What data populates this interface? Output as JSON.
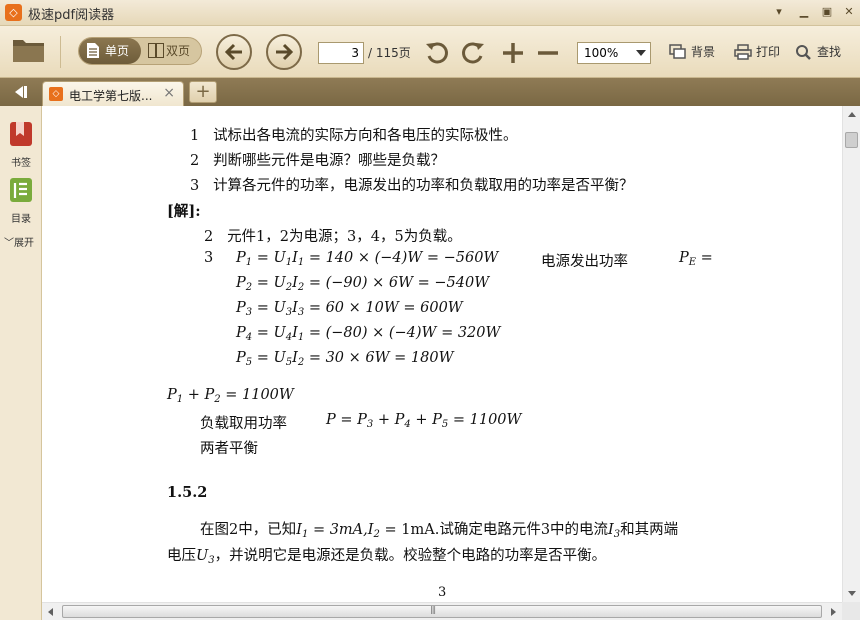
{
  "app": {
    "title": "极速pdf阅读器"
  },
  "toolbar": {
    "single_page_label": "单页",
    "double_page_label": "双页",
    "current_page": "3",
    "page_total": "/ 115页",
    "zoom": "100%",
    "background_label": "背景",
    "print_label": "打印",
    "search_label": "查找"
  },
  "tabs": [
    {
      "label": "电工学第七版..."
    }
  ],
  "sidebar": {
    "bookmarks_label": "书签",
    "toc_label": "目录",
    "expand_label": "展开"
  },
  "document": {
    "q1_num": "1",
    "q1": "试标出各电流的实际方向和各电压的实际极性。",
    "q2_num": "2",
    "q2": "判断哪些元件是电源？哪些是负载？",
    "q3_num": "3",
    "q3": "计算各元件的功率，电源发出的功率和负载取用的功率是否平衡？",
    "solution_label": "[解]:",
    "a2_num": "2",
    "a2": "元件1，2为电源；3，4，5为负载。",
    "a3_num": "3",
    "p1_rhs": " = 140 × (−4)W = −560W",
    "source_power_label": "电源发出功率",
    "pe_rhs": " =",
    "p2_rhs": " = (−90) × 6W = −540W",
    "p3_rhs": " = 60 × 10W = 600W",
    "p4_rhs": " = (−80) × (−4)W = 320W",
    "p5_rhs": " = 30 × 6W = 180W",
    "sum_rhs": " = 1100W",
    "load_power_label": "负载取用功率",
    "load_rhs": " = 1100W",
    "balance_text": "两者平衡",
    "section": "1.5.2",
    "para1_a": "在图2中，已知",
    "para1_b": " = 3mA,",
    "para1_c": " = 1mA.试确定电路元件3中的电流",
    "para1_d": "和其两端",
    "para2_a": "电压",
    "para2_b": "，并说明它是电源还是负载。校验整个电路的功率是否平衡。",
    "page_number": "3"
  },
  "colors": {
    "accent": "#e8701c",
    "toolbar": "#efe4c9",
    "tabbar": "#7a6844"
  }
}
